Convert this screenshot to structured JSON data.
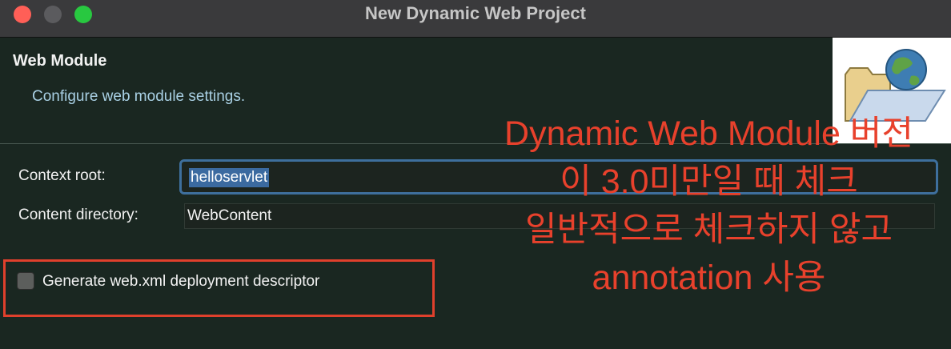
{
  "window": {
    "title": "New Dynamic Web Project"
  },
  "header": {
    "title": "Web Module",
    "description": "Configure web module settings."
  },
  "form": {
    "context_root": {
      "label": "Context root:",
      "value": "helloservlet"
    },
    "content_directory": {
      "label": "Content directory:",
      "value": "WebContent"
    },
    "generate_descriptor": {
      "label": "Generate web.xml deployment descriptor",
      "checked": false
    }
  },
  "annotation": {
    "lines": [
      "Dynamic Web Module 버전",
      "이 3.0미만일 때 체크",
      "일반적으로 체크하지 않고",
      "annotation 사용"
    ],
    "color": "#e8412c"
  },
  "colors": {
    "background": "#1a2721",
    "accent": "#3e6f9d",
    "highlight_border": "#e0402c"
  },
  "icons": [
    "close-button",
    "minimize-button",
    "maximize-button",
    "web-project-folder-globe-icon"
  ]
}
